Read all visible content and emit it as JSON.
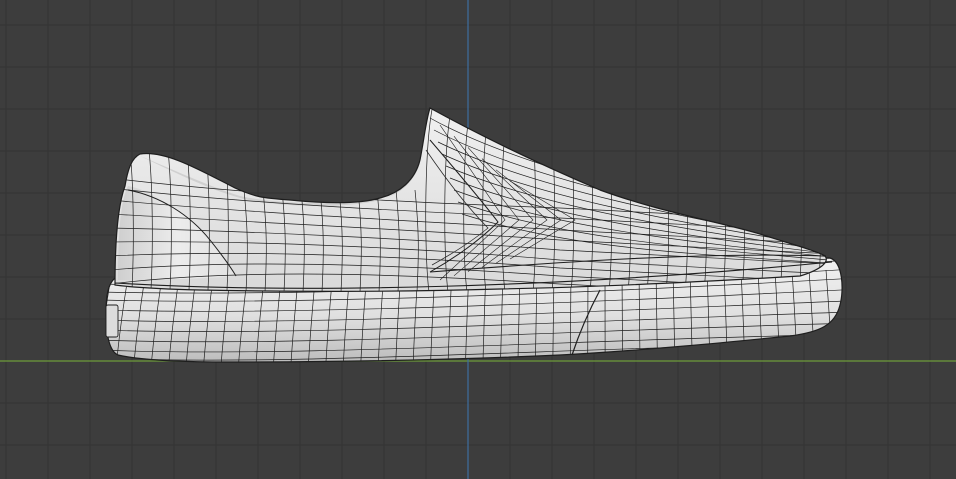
{
  "viewport": {
    "view": "side-orthographic",
    "background_color": "#3d3d3d",
    "grid": {
      "visible": true,
      "line_color": "#333333",
      "x_axis_color": "#6e9b3b",
      "y_axis_color": "#3e6ea0"
    },
    "object": {
      "type": "mesh",
      "shape": "slip-on-sneaker",
      "display": "solid-with-wireframe",
      "surface_color": "#e6e6e6",
      "shadow_color": "#b4b4b4",
      "wire_color": "#1e1e1e"
    }
  }
}
